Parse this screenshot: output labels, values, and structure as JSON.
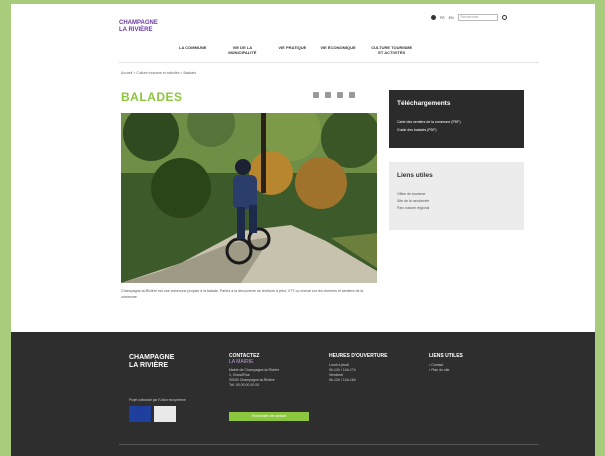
{
  "header": {
    "logo": [
      "CHAMPAGNE",
      "LA RIVIÈRE"
    ],
    "lang": "FR",
    "lang_alt": "EN",
    "search_placeholder": "Rechercher"
  },
  "nav": [
    "LA COMMUNE",
    "VIE DE LA MUNICIPALITÉ",
    "VIE PRATIQUE",
    "VIE ÉCONOMIQUE",
    "CULTURE TOURISME ET ACTIVITÉS"
  ],
  "breadcrumb": "Accueil > Culture tourisme et activités > Balades",
  "page": {
    "title": "BALADES",
    "caption": "Champagne-la-Rivière est une commune propice à la balade. Partez à la découverte du territoire à pied, VTT ou cheval sur les chemins et sentiers de la commune."
  },
  "downloads": {
    "title": "Téléchargements",
    "items": [
      "Carte des sentiers de la commune (PDF)",
      "Guide des balades (PDF)"
    ]
  },
  "links": {
    "title": "Liens utiles",
    "items": [
      "Office de tourisme",
      "Site de la randonnée",
      "Parc naturel régional"
    ]
  },
  "footer": {
    "logo": [
      "CHAMPAGNE",
      "LA RIVIÈRE"
    ],
    "partners_label": "Projet cofinancé par l'Union européenne",
    "contact": {
      "title": "CONTACTEZ",
      "subtitle": "LA MAIRIE",
      "lines": [
        "Mairie de Champagne-la-Rivière",
        "1, Grand'Rue",
        "00000 Champagne-la-Rivière",
        "Tél. 00 00 00 00 00"
      ],
      "button": "Formulaire de contact"
    },
    "hours": {
      "title": "HEURES D'OUVERTURE",
      "lines": [
        "Lundi à jeudi",
        "9h-12h / 14h-17h",
        "Vendredi",
        "9h-12h / 14h-16h"
      ]
    },
    "links": {
      "title": "LIENS UTILES",
      "lines": [
        "• Contact",
        "• Plan du site"
      ]
    }
  },
  "colors": {
    "accent": "#8cc63f",
    "brand": "#6b3aa0",
    "footer": "#2e2e2e",
    "bg": "#a9cc7c"
  }
}
